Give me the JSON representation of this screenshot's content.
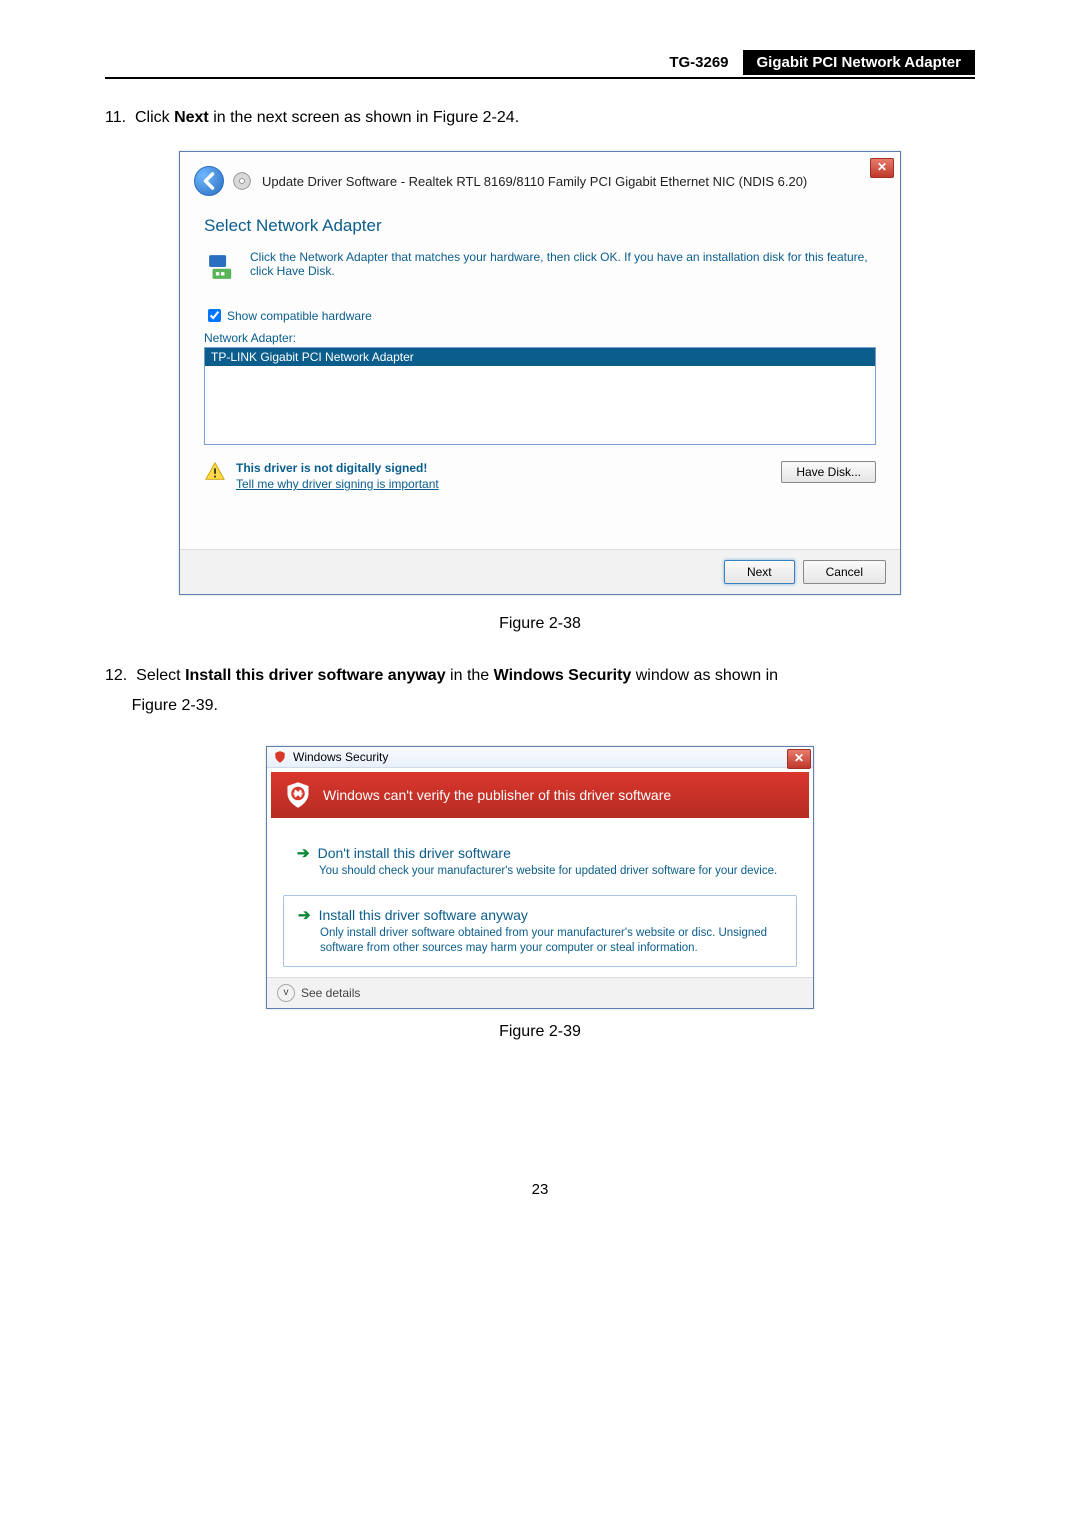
{
  "header": {
    "model": "TG-3269",
    "title": "Gigabit PCI Network Adapter"
  },
  "step11": {
    "number": "11.",
    "pre": "Click ",
    "bold": "Next",
    "post": " in the next screen as shown in Figure 2-24."
  },
  "dialog1": {
    "title": "Update Driver Software - Realtek RTL 8169/8110 Family PCI Gigabit Ethernet NIC (NDIS 6.20)",
    "section_title": "Select Network Adapter",
    "help_text": "Click the Network Adapter that matches your hardware, then click OK. If you have an installation disk for this feature, click Have Disk.",
    "show_compat_label": "Show compatible hardware",
    "list_label": "Network Adapter:",
    "list_item": "TP-LINK Gigabit PCI Network Adapter",
    "warn_bold": "This driver is not digitally signed!",
    "warn_link": "Tell me why driver signing is important",
    "have_disk": "Have Disk...",
    "next": "Next",
    "cancel": "Cancel"
  },
  "caption1": "Figure 2-38",
  "step12": {
    "number": "12.",
    "pre": "Select ",
    "bold1": "Install this driver software anyway",
    "mid": " in the ",
    "bold2": "Windows Security",
    "post1": " window as shown in ",
    "post2": "Figure 2-39."
  },
  "dialog2": {
    "title": "Windows Security",
    "banner": "Windows can't verify the publisher of this driver software",
    "opt1_title": "Don't install this driver software",
    "opt1_sub": "You should check your manufacturer's website for updated driver software for your device.",
    "opt2_title": "Install this driver software anyway",
    "opt2_sub": "Only install driver software obtained from your manufacturer's website or disc. Unsigned software from other sources may harm your computer or steal information.",
    "see_details": "See details"
  },
  "caption2": "Figure 2-39",
  "page_number": "23"
}
